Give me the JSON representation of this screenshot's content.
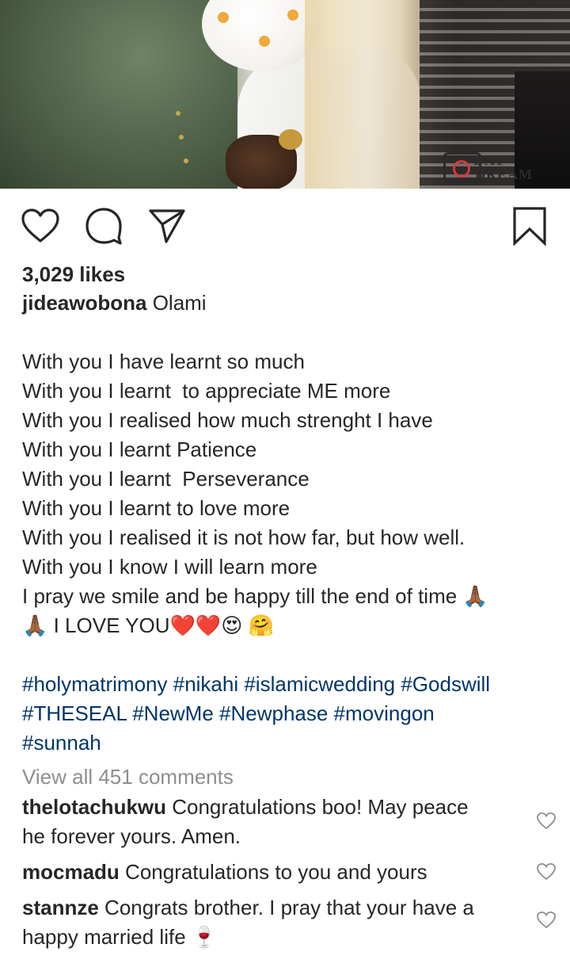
{
  "post": {
    "likes": "3,029 likes",
    "author": "jideawobona",
    "caption_first": " Olami",
    "caption_lines": [
      "With you I have learnt so much",
      "With you I learnt  to appreciate ME more",
      "With you I realised how much strenght I have",
      "With you I learnt Patience",
      "With you I learnt  Perseverance",
      "With you I learnt to love more",
      "With you I realised it is not how far, but how well.",
      "With you I know I will learn more",
      "I pray we smile and be happy till the end of time 🙏🏾",
      "🙏🏾 I LOVE YOU❤️❤️😍 🤗"
    ],
    "hashtag_lines": [
      "#holymatrimony #nikahi #islamicwedding #Godswill",
      "#THESEAL #NewMe #Newphase #movingon",
      "#sunnah"
    ],
    "view_all_comments": "View all 451 comments"
  },
  "comments": [
    {
      "user": "thelotachukwu",
      "text": " Congratulations boo! May peace",
      "text2": "he forever yours. Amen."
    },
    {
      "user": "mocmadu",
      "text": " Congratulations to you and yours",
      "text2": ""
    },
    {
      "user": "stannze",
      "text": " Congrats brother. I pray that your have a",
      "text2": "happy married life 🍷"
    }
  ],
  "photo": {
    "watermark_line1": "DAY",
    "watermark_line2": "DREAM"
  },
  "icons": {
    "like": "heart-icon",
    "comment": "comment-bubble-icon",
    "share": "paper-plane-icon",
    "save": "bookmark-icon",
    "comment_like": "small-heart-icon"
  },
  "colors": {
    "text": "#262626",
    "hashtag": "#003569",
    "muted": "#8e8e8e"
  }
}
